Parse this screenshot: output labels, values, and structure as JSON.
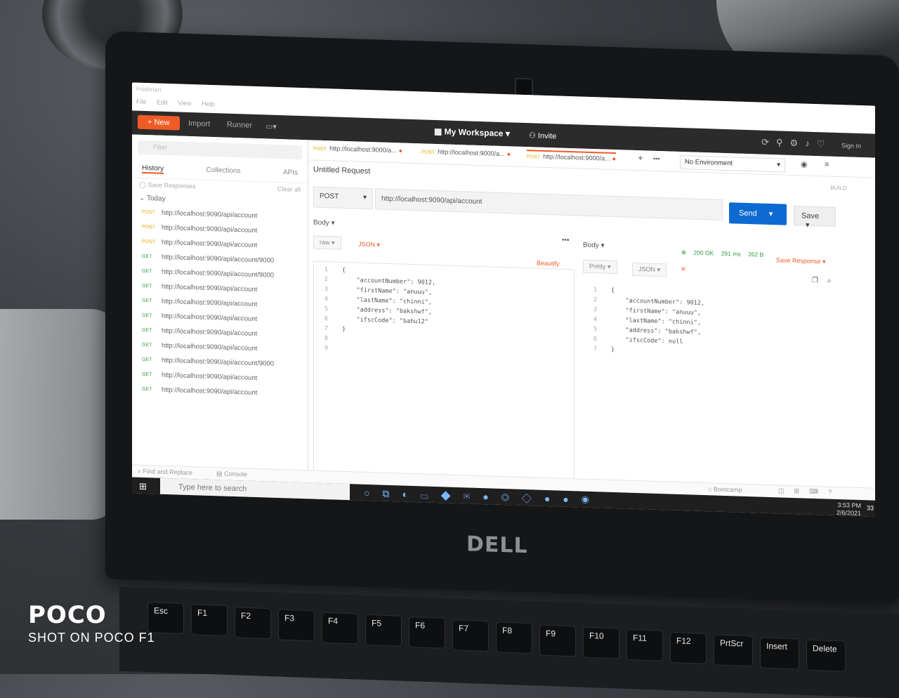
{
  "app": {
    "title": "Postman",
    "menu": [
      "File",
      "Edit",
      "View",
      "Help"
    ],
    "new_label": "New",
    "import_label": "Import",
    "runner_label": "Runner",
    "workspace_label": "My Workspace",
    "invite_label": "Invite",
    "sign_in_label": "Sign In"
  },
  "sidebar": {
    "filter_placeholder": "Filter",
    "tabs": [
      "History",
      "Collections",
      "APIs"
    ],
    "save_responses_label": "Save Responses",
    "clear_all_label": "Clear all",
    "section_label": "Today",
    "history": [
      {
        "method": "POST",
        "url": "http://localhost:9090/api/account"
      },
      {
        "method": "POST",
        "url": "http://localhost:9090/api/account"
      },
      {
        "method": "POST",
        "url": "http://localhost:9090/api/account"
      },
      {
        "method": "GET",
        "url": "http://localhost:9090/api/account/9000"
      },
      {
        "method": "GET",
        "url": "http://localhost:9090/api/account/9000"
      },
      {
        "method": "GET",
        "url": "http://localhost:9090/api/account"
      },
      {
        "method": "GET",
        "url": "http://localhost:9090/api/account"
      },
      {
        "method": "GET",
        "url": "http://localhost:9090/api/account"
      },
      {
        "method": "GET",
        "url": "http://localhost:9090/api/account"
      },
      {
        "method": "GET",
        "url": "http://localhost:9090/api/account"
      },
      {
        "method": "GET",
        "url": "http://localhost:9090/api/account/9000"
      },
      {
        "method": "GET",
        "url": "http://localhost:9090/api/account"
      },
      {
        "method": "GET",
        "url": "http://localhost:9090/api/account"
      }
    ]
  },
  "tabs": [
    {
      "method": "POST",
      "label": "http://localhost:9000/a..."
    },
    {
      "method": "POST",
      "label": "http://localhost:9000/a..."
    },
    {
      "method": "POST",
      "label": "http://localhost:9000/a..."
    }
  ],
  "environment": "No Environment",
  "request": {
    "title": "Untitled Request",
    "build_label": "BUILD",
    "method": "POST",
    "url": "http://localhost:9090/api/account",
    "send_label": "Send",
    "save_label": "Save",
    "body_label": "Body",
    "raw_label": "raw",
    "json_label": "JSON",
    "beautify_label": "Beautify",
    "line_numbers": [
      "1",
      "2",
      "3",
      "4",
      "5",
      "6",
      "7",
      "8",
      "9"
    ],
    "code_lines": [
      "{",
      "    \"accountNumber\": 9012,",
      "    \"firstName\": \"anuuu\",",
      "    \"lastName\": \"chinni\",",
      "    \"address\": \"bakshwf\",",
      "    \"ifscCode\": \"bahu12\"",
      "}",
      "",
      ""
    ]
  },
  "response": {
    "body_label": "Body",
    "status": "200 OK",
    "time": "291 ms",
    "size": "262 B",
    "save_response_label": "Save Response",
    "pretty_label": "Pretty",
    "json_label": "JSON",
    "line_numbers": [
      "1",
      "2",
      "3",
      "4",
      "5",
      "6",
      "7"
    ],
    "code_lines": [
      "{",
      "    \"accountNumber\": 9012,",
      "    \"firstName\": \"anuuu\",",
      "    \"lastName\": \"chinni\",",
      "    \"address\": \"bakshwf\",",
      "    \"ifscCode\": null",
      "}"
    ]
  },
  "bottom": {
    "find_replace_label": "Find and Replace",
    "console_label": "Console",
    "bootcamp_label": "Bootcamp"
  },
  "taskbar": {
    "search_placeholder": "Type here to search",
    "time": "3:53 PM",
    "date": "2/6/2021",
    "notification_count": "33"
  },
  "hardware": {
    "logo": "DELL",
    "keys": [
      "Esc",
      "F1",
      "F2",
      "F3",
      "F4",
      "F5",
      "F6",
      "F7",
      "F8",
      "F9",
      "F10",
      "F11",
      "F12",
      "PrtScr",
      "Insert",
      "Delete"
    ]
  },
  "watermark": {
    "brand": "POCO",
    "subtitle": "SHOT ON POCO F1"
  }
}
